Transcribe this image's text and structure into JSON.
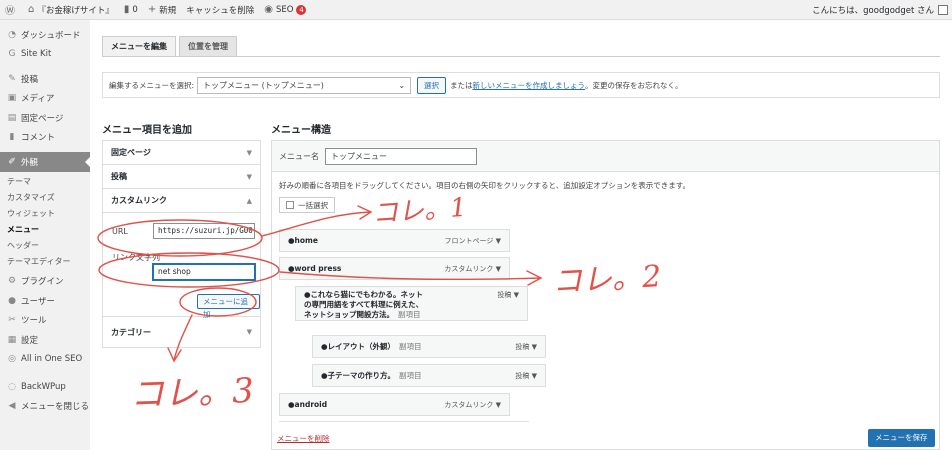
{
  "adminbar": {
    "wp_logo": "wordpress-icon",
    "site_name": "『お金稼げサイト』",
    "comments_count": "0",
    "new_label": "新規",
    "cache_label": "キャッシュを削除",
    "seo_label": "SEO",
    "seo_badge": "4",
    "greeting": "こんにちは、goodgodget さん"
  },
  "sidebar": {
    "items": [
      {
        "label": "ダッシュボード",
        "icon": "gauge-icon"
      },
      {
        "label": "Site Kit",
        "icon": "g-icon"
      },
      {
        "label": "投稿",
        "icon": "pin-icon"
      },
      {
        "label": "メディア",
        "icon": "media-icon"
      },
      {
        "label": "固定ページ",
        "icon": "page-icon"
      },
      {
        "label": "コメント",
        "icon": "comment-icon"
      },
      {
        "label": "外観",
        "icon": "brush-icon"
      },
      {
        "label": "プラグイン",
        "icon": "plugin-icon"
      },
      {
        "label": "ユーザー",
        "icon": "user-icon"
      },
      {
        "label": "ツール",
        "icon": "wrench-icon"
      },
      {
        "label": "設定",
        "icon": "settings-icon"
      },
      {
        "label": "All in One SEO",
        "icon": "aioseo-icon"
      },
      {
        "label": "BackWPup",
        "icon": "backwpup-icon"
      },
      {
        "label": "メニューを閉じる",
        "icon": "collapse-icon"
      }
    ],
    "submenu": [
      "テーマ",
      "カスタマイズ",
      "ウィジェット",
      "メニュー",
      "ヘッダー",
      "テーマエディター"
    ]
  },
  "tabs": {
    "edit": "メニューを編集",
    "manage": "位置を管理"
  },
  "selectbar": {
    "label": "編集するメニューを選択:",
    "selected": "トップメニュー (トップメニュー)",
    "select_button": "選択",
    "or_text": "または",
    "create_link": "新しいメニューを作成しましょう",
    "tail": "。変更の保存をお忘れなく。"
  },
  "add_items": {
    "title": "メニュー項目を追加",
    "pages": "固定ページ",
    "posts": "投稿",
    "custom_links": "カスタムリンク",
    "url_label": "URL",
    "url_value": "https://suzuri.jp/G00",
    "link_text_label": "リンク文字列",
    "link_text_value": "net shop",
    "add_button": "メニューに追加",
    "categories": "カテゴリー"
  },
  "structure": {
    "title": "メニュー構造",
    "name_label": "メニュー名",
    "name_value": "トップメニュー",
    "hint": "好みの順番に各項目をドラッグしてください。項目の右側の矢印をクリックすると、追加設定オプションを表示できます。",
    "bulk_select": "一括選択",
    "items": [
      {
        "title": "home",
        "type": "フロントページ"
      },
      {
        "title": "word press",
        "type": "カスタムリンク"
      },
      {
        "title_line1": "これなら猫にでもわかる。ネット",
        "title_line2": "の専門用語をすべて料理に例えた、",
        "title_line3": "ネットショップ開設方法。",
        "sub": "副項目",
        "type": "投稿"
      },
      {
        "title": "レイアウト（外観）",
        "sub": "副項目",
        "type": "投稿"
      },
      {
        "title": "子テーマの作り方。",
        "sub": "副項目",
        "type": "投稿"
      },
      {
        "title": "android",
        "type": "カスタムリンク"
      }
    ],
    "delete_link": "メニューを削除",
    "save_button": "メニューを保存"
  },
  "annotations": {
    "note1": "コレ。1",
    "note2": "コレ。2",
    "note3": "コレ。3",
    "color": "#e0524a"
  }
}
